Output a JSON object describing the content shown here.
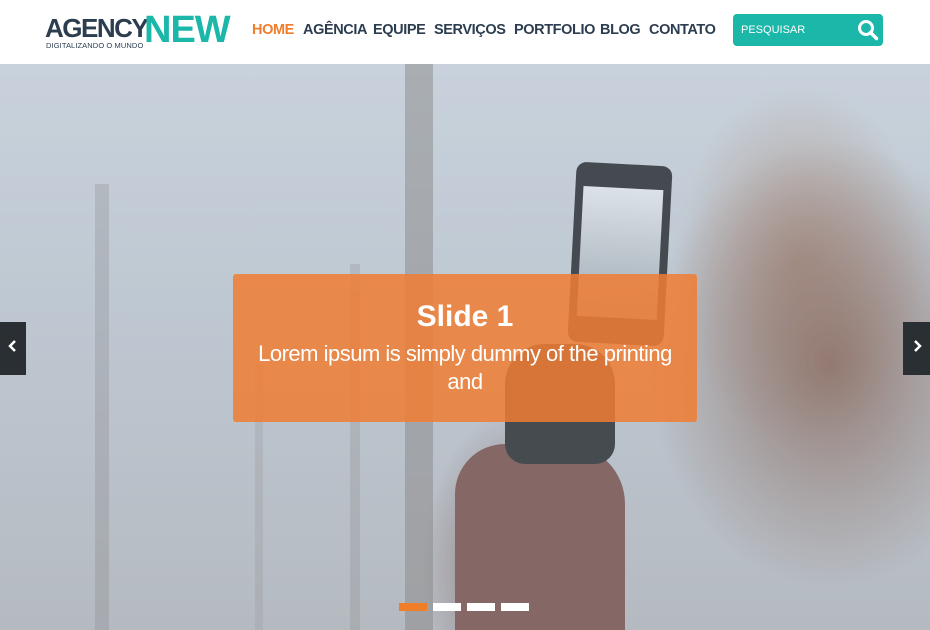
{
  "brand": {
    "name_part1": "AGENCY",
    "name_part2": "NEW",
    "tagline": "DIGITALIZANDO O MUNDO"
  },
  "nav": {
    "items": [
      {
        "label": "HOME",
        "active": true
      },
      {
        "label": "AGÊNCIA",
        "active": false
      },
      {
        "label": "EQUIPE",
        "active": false
      },
      {
        "label": "SERVIÇOS",
        "active": false
      },
      {
        "label": "PORTFOLIO",
        "active": false
      },
      {
        "label": "BLOG",
        "active": false
      },
      {
        "label": "CONTATO",
        "active": false
      }
    ]
  },
  "search": {
    "placeholder": "PESQUISAR",
    "value": "",
    "icon": "search-icon"
  },
  "slider": {
    "slide_title": "Slide 1",
    "slide_text": "Lorem ipsum is simply dummy of the printing and",
    "prev_icon": "chevron-left-icon",
    "next_icon": "chevron-right-icon",
    "slide_count": 4,
    "active_index": 0
  },
  "colors": {
    "accent_orange": "#f07d2a",
    "accent_teal": "#1bb7a8",
    "text_dark": "#2b3d4f"
  }
}
